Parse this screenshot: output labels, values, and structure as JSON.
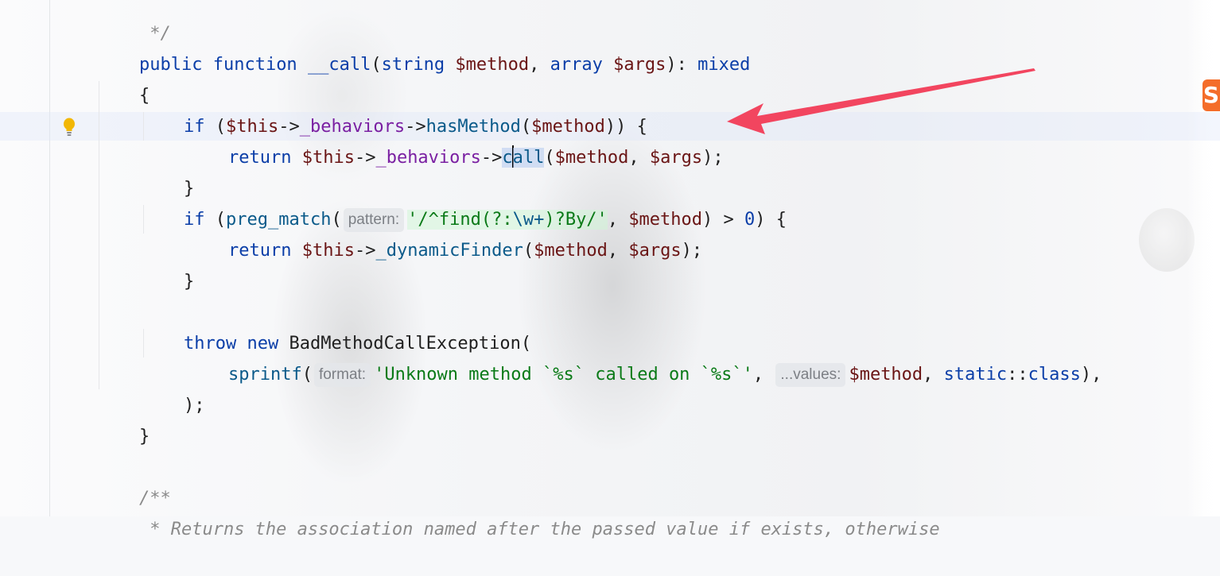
{
  "editor": {
    "lines": {
      "l0": {
        "comment_close": " */"
      },
      "l1": {
        "kw_public": "public",
        "kw_function": "function",
        "name": "__call",
        "p1": "(",
        "type1": "string",
        "var1": "$method",
        "comma1": ", ",
        "type2": "array",
        "var2": "$args",
        "p2": "): ",
        "ret_type": "mixed"
      },
      "l2": {
        "brace": "{"
      },
      "l3": {
        "kw_if": "if",
        "p1": " (",
        "this": "$this",
        "arrow1": "->",
        "prop": "_behaviors",
        "arrow2": "->",
        "method": "hasMethod",
        "p2": "(",
        "var": "$method",
        "p3": ")) {"
      },
      "l4": {
        "kw_return": "return",
        "this": "$this",
        "arrow1": "->",
        "prop": "_behaviors",
        "arrow2": "->",
        "method_a": "c",
        "method_b": "all",
        "p1": "(",
        "var1": "$method",
        "comma": ", ",
        "var2": "$args",
        "p2": ");"
      },
      "l5": {
        "brace": "}"
      },
      "l6": {
        "kw_if": "if",
        "p1": " (",
        "fn": "preg_match",
        "p2": "(",
        "hint": "pattern:",
        "str_a": "'/^find(?:",
        "str_esc": "\\w+",
        "str_b": ")?By/'",
        "comma": ", ",
        "var": "$method",
        "p3": ") > ",
        "num": "0",
        "p4": ") {"
      },
      "l7": {
        "kw_return": "return",
        "this": "$this",
        "arrow": "->",
        "method": "_dynamicFinder",
        "p1": "(",
        "var1": "$method",
        "comma": ", ",
        "var2": "$args",
        "p2": ");"
      },
      "l8": {
        "brace": "}"
      },
      "l9": {
        "kw_throw": "throw",
        "kw_new": "new",
        "cls": "BadMethodCallException",
        "p1": "("
      },
      "l10": {
        "fn": "sprintf",
        "p1": "(",
        "hint1": "format:",
        "str": "'Unknown method `%s` called on `%s`'",
        "comma1": ", ",
        "hint2": "...values:",
        "var": "$method",
        "comma2": ", ",
        "kw_static": "static",
        "dc": "::",
        "kw_class": "class",
        "p2": "),"
      },
      "l11": {
        "close": ");"
      },
      "l12": {
        "brace": "}"
      },
      "l13": {
        "doc_open": "/**"
      },
      "l14": {
        "doc_text": " * Returns the association named after the passed value if exists, otherwise"
      }
    },
    "logo_letter": "S",
    "colors": {
      "keyword": "#0b3ea8",
      "variable": "#6a1515",
      "property": "#7a1fa2",
      "string": "#0a7a17",
      "comment": "#8a8a8a",
      "annotation_arrow": "#f2455f"
    }
  }
}
